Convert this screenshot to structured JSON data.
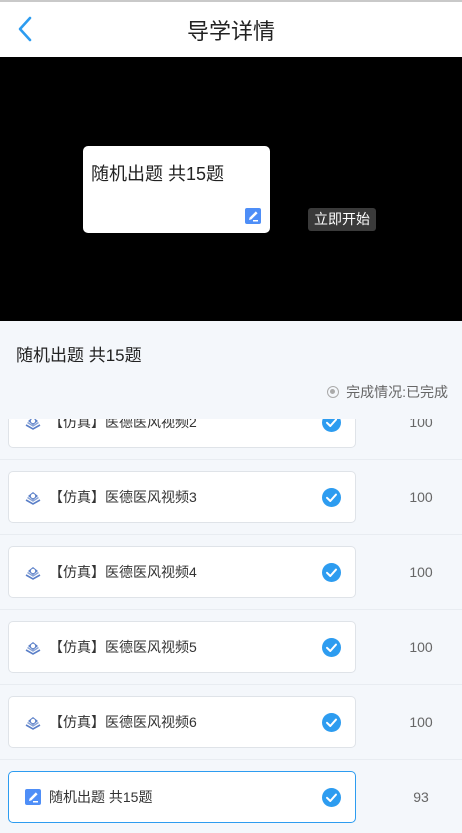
{
  "header": {
    "title": "导学详情",
    "back_icon": "chevron-left-icon"
  },
  "player": {
    "card_title": "随机出题 共15题",
    "card_icon": "edit-icon",
    "start_label": "立即开始"
  },
  "info": {
    "title": "随机出题 共15题",
    "status_text": "完成情况:已完成"
  },
  "colors": {
    "accent": "#2d9cf0",
    "edit_icon": "#4e8ef7",
    "video_icon": "#5a7fc8"
  },
  "items": [
    {
      "type": "video",
      "icon": "video-icon",
      "label": "【仿真】医德医风视频2",
      "score": "100",
      "completed": true
    },
    {
      "type": "video",
      "icon": "video-icon",
      "label": "【仿真】医德医风视频3",
      "score": "100",
      "completed": true
    },
    {
      "type": "video",
      "icon": "video-icon",
      "label": "【仿真】医德医风视频4",
      "score": "100",
      "completed": true
    },
    {
      "type": "video",
      "icon": "video-icon",
      "label": "【仿真】医德医风视频5",
      "score": "100",
      "completed": true
    },
    {
      "type": "video",
      "icon": "video-icon",
      "label": "【仿真】医德医风视频6",
      "score": "100",
      "completed": true
    },
    {
      "type": "quiz",
      "icon": "edit-icon",
      "label": "随机出题 共15题",
      "score": "93",
      "completed": true,
      "active": true
    }
  ]
}
